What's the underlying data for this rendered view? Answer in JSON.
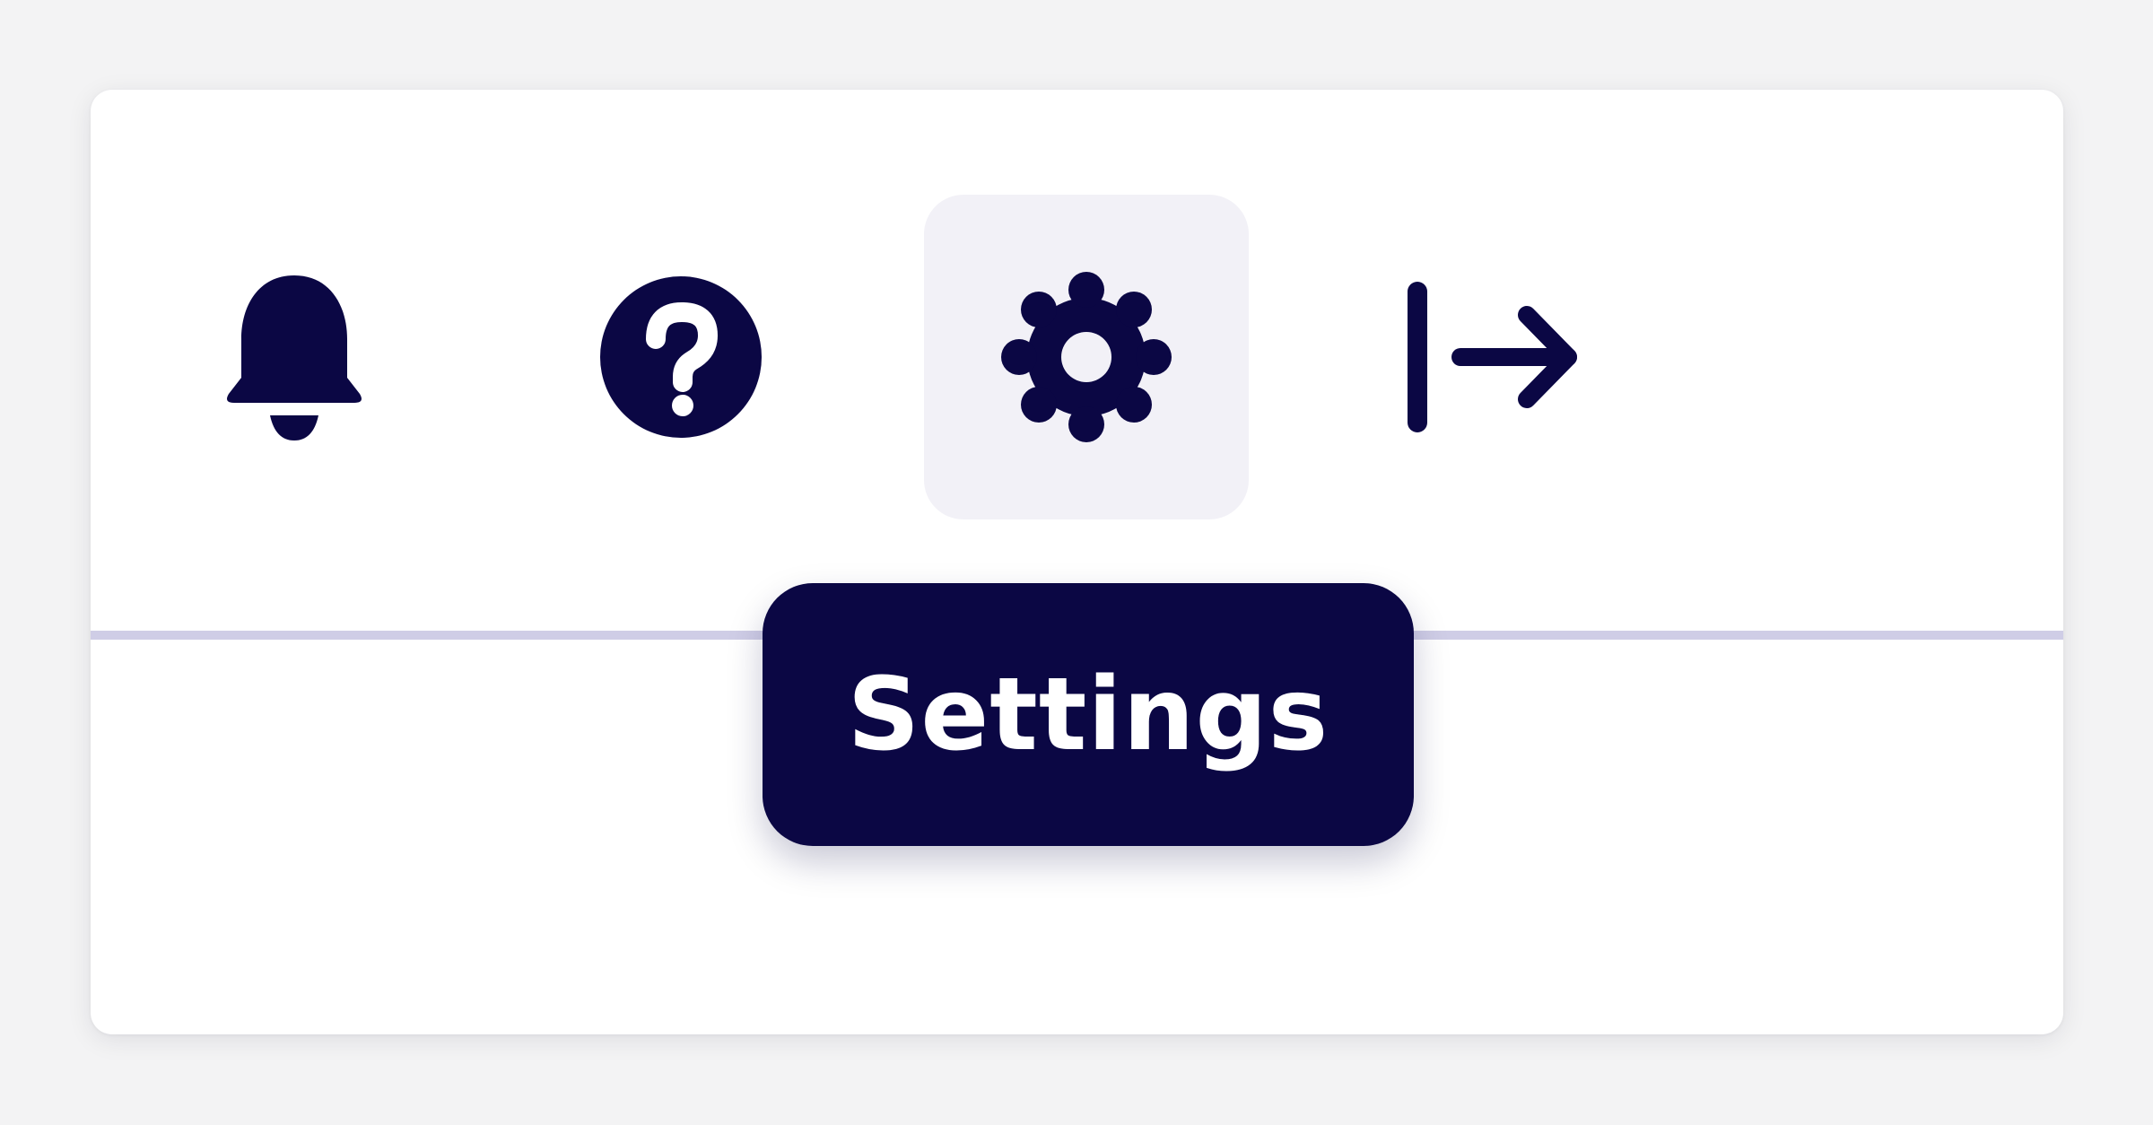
{
  "toolbar": {
    "items": [
      {
        "id": "notifications",
        "icon": "bell-icon",
        "active": false
      },
      {
        "id": "help",
        "icon": "question-circle-icon",
        "active": false
      },
      {
        "id": "settings",
        "icon": "gear-icon",
        "active": true
      },
      {
        "id": "logout",
        "icon": "logout-arrow-icon",
        "active": false
      }
    ]
  },
  "tooltip": {
    "label": "Settings"
  },
  "colors": {
    "icon": "#0b0744",
    "active_bg": "#f2f1f7",
    "divider": "#cfcde6",
    "tooltip_bg": "#0b0744",
    "tooltip_text": "#ffffff",
    "page_bg": "#f3f3f4",
    "card_bg": "#ffffff"
  }
}
